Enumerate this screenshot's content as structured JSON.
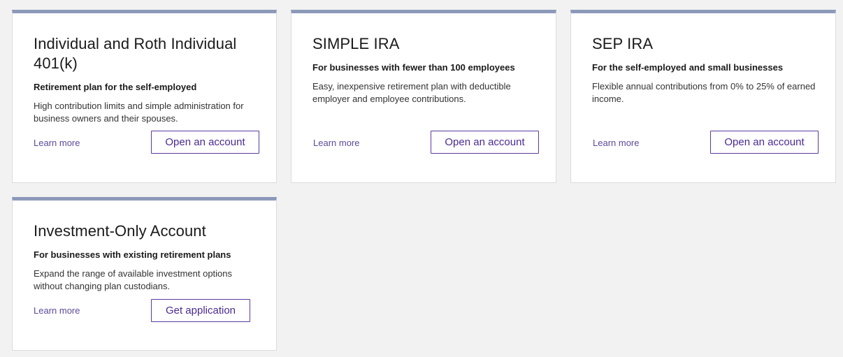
{
  "cards": [
    {
      "title": "Individual and Roth Individual 401(k)",
      "subtitle": "Retirement plan for the self-employed",
      "description": "High contribution limits and simple administration for business owners and their spouses.",
      "learn_more": "Learn more",
      "action_label": "Open an account"
    },
    {
      "title": "SIMPLE IRA",
      "subtitle": "For businesses with fewer than 100 employees",
      "description": "Easy, inexpensive retirement plan with deductible employer and employee contributions.",
      "learn_more": "Learn more",
      "action_label": "Open an account"
    },
    {
      "title": "SEP IRA",
      "subtitle": "For the self-employed and small businesses",
      "description": "Flexible annual contributions from 0% to 25% of earned income.",
      "learn_more": "Learn more",
      "action_label": "Open an account"
    },
    {
      "title": "Investment-Only Account",
      "subtitle": "For businesses with existing retirement plans",
      "description": "Expand the range of available investment options without changing plan custodians.",
      "learn_more": "Learn more",
      "action_label": "Get application"
    }
  ],
  "colors": {
    "page_background": "#f2f2f2",
    "card_background": "#ffffff",
    "card_top_accent": "#8c99ba",
    "link": "#5c4b9a",
    "button_border": "#5b3a9e",
    "button_text": "#4a2a92"
  }
}
